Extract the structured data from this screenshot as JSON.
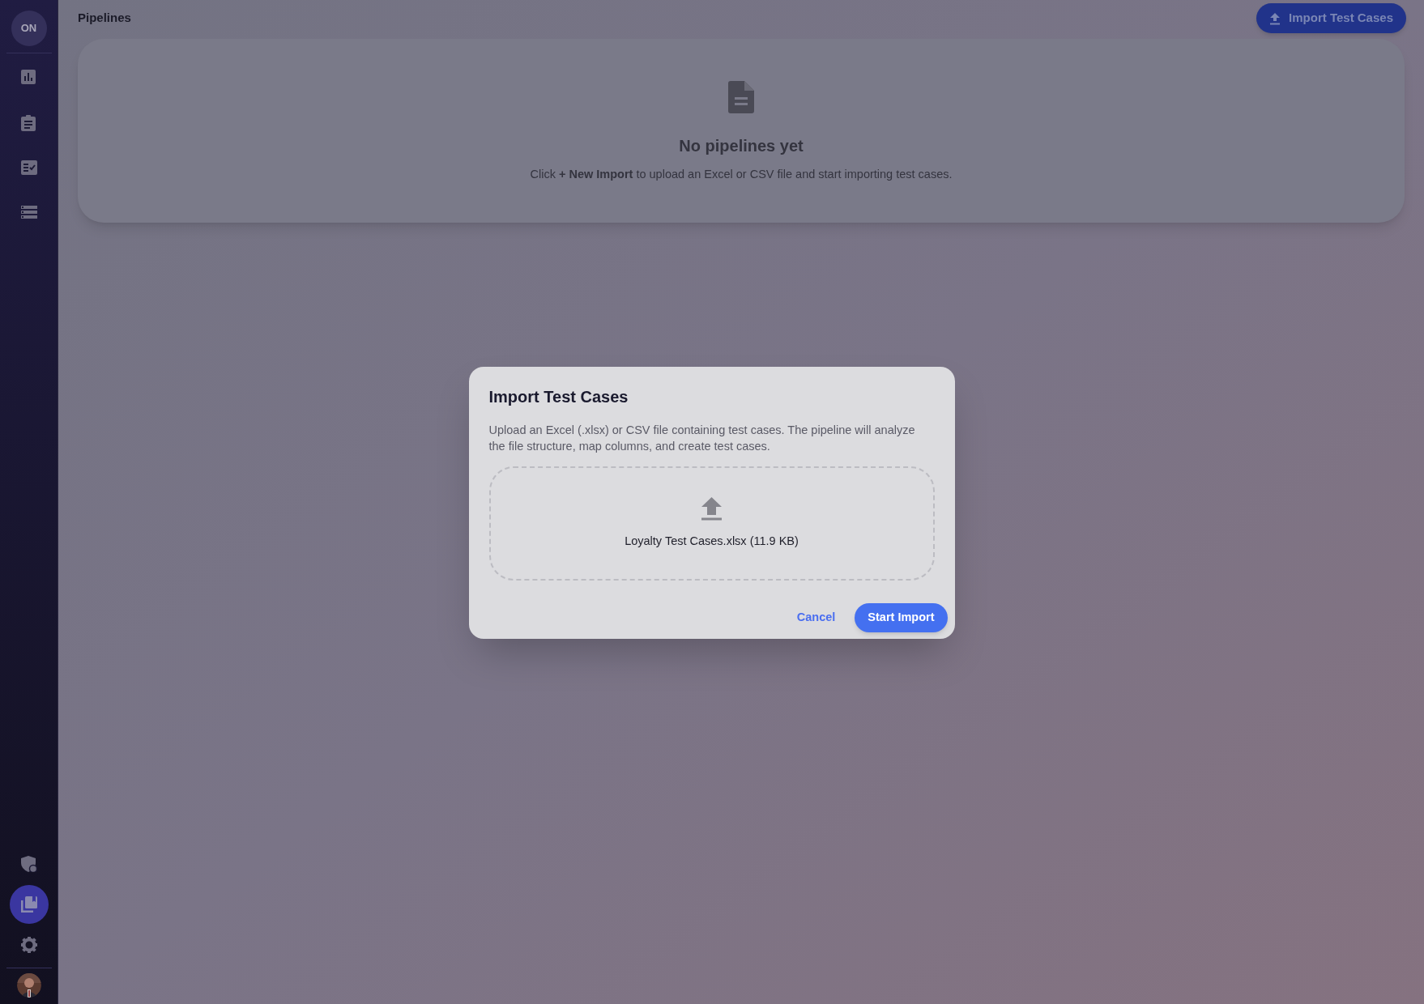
{
  "sidebar": {
    "logo": "ON",
    "top_items": [
      {
        "kind": "chart",
        "selected": false
      },
      {
        "kind": "clipboard",
        "selected": false
      },
      {
        "kind": "checklist",
        "selected": false
      },
      {
        "kind": "list",
        "selected": false
      }
    ],
    "bottom_items": [
      {
        "kind": "shield",
        "selected": false
      },
      {
        "kind": "library",
        "selected": true
      },
      {
        "kind": "gear",
        "selected": false
      }
    ]
  },
  "header": {
    "title": "Pipelines",
    "action_button": "Import Test Cases"
  },
  "empty_state": {
    "title": "No pipelines yet",
    "message": "Click **+ New Import** to upload an Excel or CSV file and start importing test cases."
  },
  "dialog": {
    "title": "Import Test Cases",
    "description": "Upload an Excel (.xlsx) or CSV file containing test cases. The pipeline will analyze the file structure, map columns, and create test cases.",
    "file_label": "Loyalty Test Cases.xlsx (11.9 KB)",
    "buttons": [
      {
        "kind": "text",
        "label": "Cancel"
      },
      {
        "kind": "primary",
        "label": "Start Import"
      }
    ]
  }
}
